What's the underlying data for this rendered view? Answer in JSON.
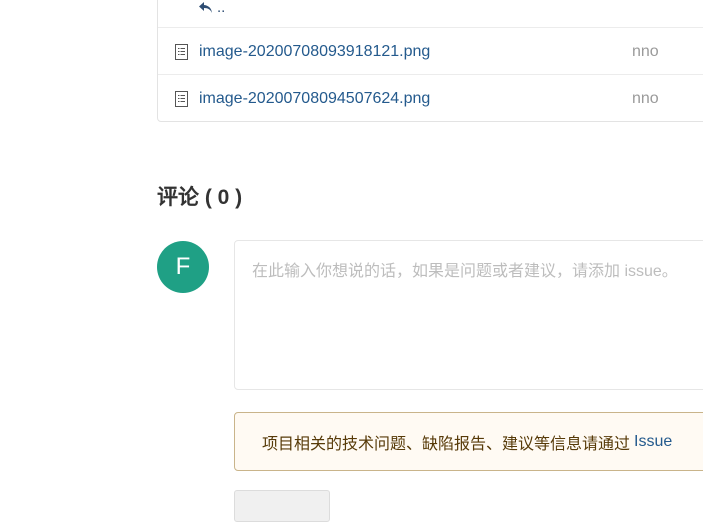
{
  "files": {
    "back_label": "..",
    "rows": [
      {
        "name": "image-20200708093918121.png",
        "author": "nno"
      },
      {
        "name": "image-20200708094507624.png",
        "author": "nno"
      }
    ]
  },
  "comments": {
    "title": "评论 ( 0 )",
    "avatar_letter": "F",
    "avatar_color": "#1fa085",
    "placeholder": "在此输入你想说的话，如果是问题或者建议，请添加 issue。",
    "notice_text": "项目相关的技术问题、缺陷报告、建议等信息请通过",
    "notice_link": "Issue"
  }
}
